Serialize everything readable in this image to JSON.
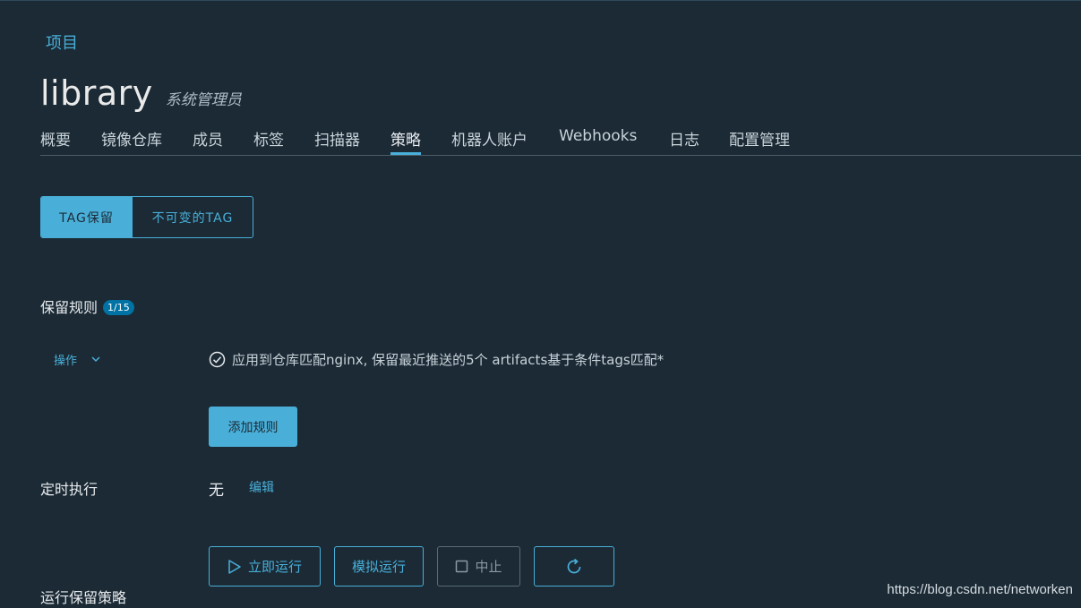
{
  "breadcrumb": "项目",
  "project": {
    "name": "library",
    "role": "系统管理员"
  },
  "tabs": [
    {
      "label": "概要",
      "active": false
    },
    {
      "label": "镜像仓库",
      "active": false
    },
    {
      "label": "成员",
      "active": false
    },
    {
      "label": "标签",
      "active": false
    },
    {
      "label": "扫描器",
      "active": false
    },
    {
      "label": "策略",
      "active": true
    },
    {
      "label": "机器人账户",
      "active": false
    },
    {
      "label": "Webhooks",
      "active": false
    },
    {
      "label": "日志",
      "active": false
    },
    {
      "label": "配置管理",
      "active": false
    }
  ],
  "segments": {
    "tag_retention": "TAG保留",
    "immutable_tag": "不可变的TAG"
  },
  "retention": {
    "label": "保留规则",
    "count_badge": "1/15",
    "action_menu": "操作",
    "rule_text": "应用到仓库匹配nginx, 保留最近推送的5个 artifacts基于条件tags匹配*",
    "add_rule": "添加规则"
  },
  "schedule": {
    "label": "定时执行",
    "value": "无",
    "edit": "编辑"
  },
  "run": {
    "label": "运行保留策略",
    "run_now": "立即运行",
    "dry_run": "模拟运行",
    "abort": "中止"
  },
  "watermark": "https://blog.csdn.net/networken",
  "colors": {
    "background": "#1b2a35",
    "accent": "#49afd9",
    "badge": "#0072a3",
    "text": "#e9ecef"
  },
  "icons": [
    "chevron-down-icon",
    "check-circle-icon",
    "play-icon",
    "stop-icon",
    "refresh-icon"
  ]
}
